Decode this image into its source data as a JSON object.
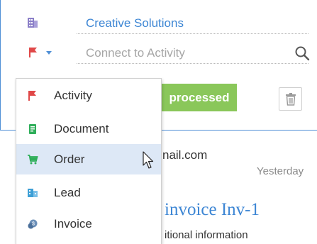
{
  "colors": {
    "accent_blue": "#3d86d4",
    "frame_blue": "#4f8fd6",
    "status_green": "#8ac75a",
    "flag_red": "#e04848",
    "hover_bg": "#dde8f6"
  },
  "card": {
    "account": {
      "icon": "building-icon",
      "value": "Creative Solutions"
    },
    "activity": {
      "icon": "flag-icon",
      "placeholder": "Connect to Activity",
      "search_icon": "search-icon"
    },
    "status": "processed",
    "delete_icon": "trash-icon",
    "email_fragment": "nail.com",
    "date": "Yesterday",
    "invoice_title": "invoice Inv-1",
    "additional_info": "itional information"
  },
  "menu": {
    "items": [
      {
        "label": "Activity",
        "icon": "flag-icon"
      },
      {
        "label": "Document",
        "icon": "document-icon"
      },
      {
        "label": "Order",
        "icon": "cart-icon"
      },
      {
        "label": "Lead",
        "icon": "lead-icon"
      },
      {
        "label": "Invoice",
        "icon": "invoice-icon"
      }
    ],
    "hovered": "Order"
  }
}
